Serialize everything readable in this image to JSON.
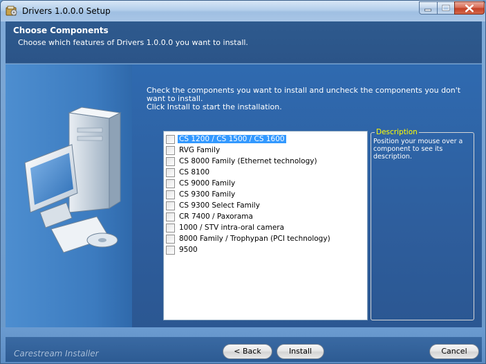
{
  "window": {
    "title": "Drivers 1.0.0.0 Setup"
  },
  "header": {
    "title": "Choose Components",
    "subtitle": "Choose which features of Drivers 1.0.0.0 you want to install."
  },
  "instruction": {
    "line1": "Check the components you want to install and uncheck the components you don't want to install.",
    "line2": "Click Install to start the installation."
  },
  "components": [
    {
      "label": "CS 1200 / CS 1500 / CS 1600",
      "checked": false,
      "selected": true
    },
    {
      "label": "RVG Family",
      "checked": false,
      "selected": false
    },
    {
      "label": "CS 8000 Family (Ethernet technology)",
      "checked": false,
      "selected": false
    },
    {
      "label": "CS 8100",
      "checked": false,
      "selected": false
    },
    {
      "label": "CS 9000 Family",
      "checked": false,
      "selected": false
    },
    {
      "label": "CS 9300 Family",
      "checked": false,
      "selected": false
    },
    {
      "label": "CS 9300 Select Family",
      "checked": false,
      "selected": false
    },
    {
      "label": "CR 7400 / Paxorama",
      "checked": false,
      "selected": false
    },
    {
      "label": "1000 / STV intra-oral camera",
      "checked": false,
      "selected": false
    },
    {
      "label": "8000 Family / Trophypan (PCI technology)",
      "checked": false,
      "selected": false
    },
    {
      "label": "9500",
      "checked": false,
      "selected": false
    }
  ],
  "description": {
    "legend": "Description",
    "text": "Position your mouse over a component to see its description."
  },
  "footer": {
    "brand": "Carestream Installer",
    "back_label": "< Back",
    "install_label": "Install",
    "cancel_label": "Cancel"
  },
  "colors": {
    "accent": "#3399ff",
    "legend": "#ffff00",
    "header_bg": "#2e5a8e"
  },
  "icons": {
    "app": "installer-icon",
    "minimize": "minimize-icon",
    "maximize": "maximize-icon",
    "close": "close-icon",
    "illustration": "computer-with-cd-icon"
  }
}
